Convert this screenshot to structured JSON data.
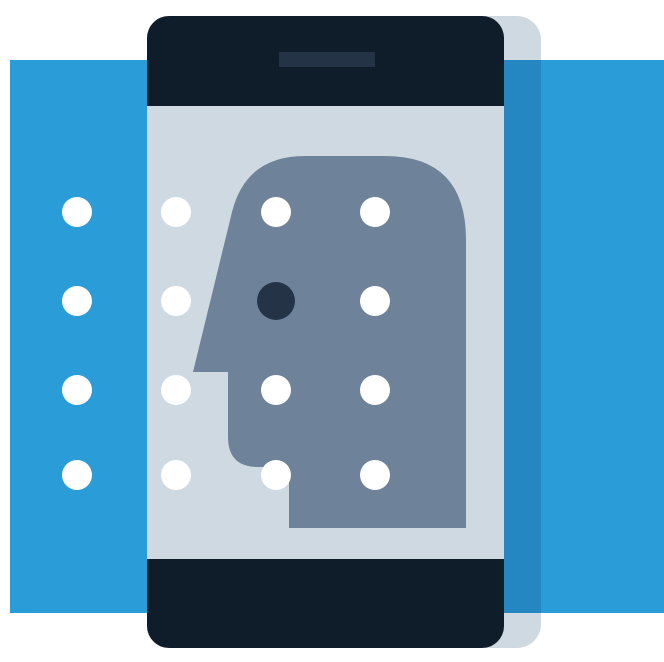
{
  "illustration": {
    "subject": "face-recognition-phone",
    "icon": "face-scan-icon"
  },
  "colors": {
    "background": "#ffffff",
    "band": "#2a9cd8",
    "band_shadow": "#2587c2",
    "phone_shadow": "#cfd9e2",
    "phone_body": "#0f1c2a",
    "speaker": "#243446",
    "screen": "#cfd9e2",
    "head": "#6e8399",
    "dot": "#ffffff",
    "dot_active": "#243446"
  },
  "dot_grid": {
    "rows": 4,
    "cols": 4,
    "active": [
      [
        1,
        2
      ]
    ]
  }
}
